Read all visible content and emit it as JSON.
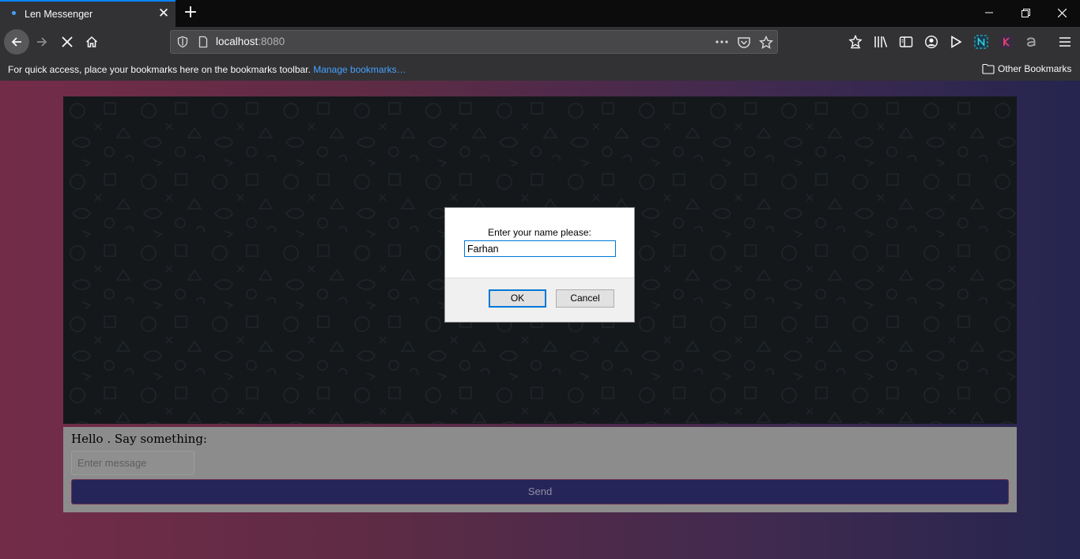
{
  "browser": {
    "tab": {
      "title": "Len Messenger",
      "close_glyph": "✕"
    },
    "new_tab_glyph": "+",
    "url": {
      "host": "localhost",
      "port": ":8080"
    },
    "toolbar_icons": [
      "library-stars-icon",
      "library-icon",
      "sidebar-icon",
      "account-icon",
      "play-icon",
      "extension-n-icon",
      "extension-k-icon",
      "extension-a-icon",
      "menu-icon"
    ]
  },
  "bookmarks_bar": {
    "hint": "For quick access, place your bookmarks here on the bookmarks toolbar.",
    "manage_link": "Manage bookmarks…",
    "other_label": "Other Bookmarks"
  },
  "page": {
    "greeting": "Hello . Say something:",
    "message_placeholder": "Enter message",
    "send_label": "Send"
  },
  "dialog": {
    "message": "Enter your name please:",
    "input_value": "Farhan",
    "ok_label": "OK",
    "cancel_label": "Cancel"
  },
  "colors": {
    "accent": "#0a84ff",
    "chat_background": "#15181b",
    "send_button": "#25255a",
    "gradient_left": "#732c48",
    "gradient_right": "#25254f"
  }
}
